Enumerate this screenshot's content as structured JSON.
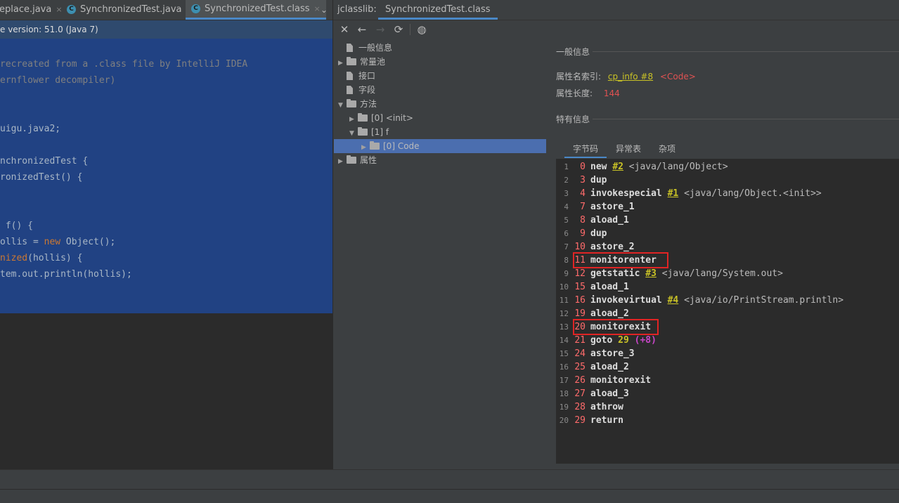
{
  "editor": {
    "tabs": [
      {
        "label": "eplace.java"
      },
      {
        "label": "SynchronizedTest.java"
      },
      {
        "label": "SynchronizedTest.class"
      }
    ],
    "tab_close": "×",
    "tab_more": "⌄",
    "infobar_text": "e version: 51.0 (Java 7)",
    "code_lines": {
      "l1": "recreated from a .class file by IntelliJ IDEA",
      "l2": "ernflower decompiler)",
      "l3": "uigu.java2;",
      "l4": "nchronizedTest {",
      "l5": "ronizedTest() {",
      "l6a": " f() {",
      "l7a": "ollis = ",
      "l7kw": "new",
      "l7b": " Object();",
      "l8kw": "nized",
      "l8b": "(hollis) {",
      "l9": "tem.out.println(hollis);"
    }
  },
  "jclasslib": {
    "label": "jclasslib:",
    "tab": "SynchronizedTest.class",
    "toolbar": {
      "close": "✕",
      "back": "←",
      "forward": "→",
      "refresh": "⟳",
      "browser": "◍"
    },
    "tree": {
      "general": "一般信息",
      "constant_pool": "常量池",
      "interfaces": "接口",
      "fields": "字段",
      "methods": "方法",
      "method0": "[0] <init>",
      "method1": "[1] f",
      "code": "[0] Code",
      "attributes": "属性"
    },
    "detail": {
      "general_header": "一般信息",
      "name_index_label": "属性名索引:",
      "name_index_link": "cp_info #8",
      "name_index_value": "<Code>",
      "length_label": "属性长度:",
      "length_value": "144",
      "specific_header": "特有信息",
      "tabs": [
        "字节码",
        "异常表",
        "杂项"
      ]
    },
    "bytecode": [
      {
        "line": "1",
        "offset": "0",
        "op": "new",
        "ref": "#2",
        "comment": "<java/lang/Object>"
      },
      {
        "line": "2",
        "offset": "3",
        "op": "dup"
      },
      {
        "line": "3",
        "offset": "4",
        "op": "invokespecial",
        "ref": "#1",
        "comment": "<java/lang/Object.<init>>"
      },
      {
        "line": "4",
        "offset": "7",
        "op": "astore_1"
      },
      {
        "line": "5",
        "offset": "8",
        "op": "aload_1"
      },
      {
        "line": "6",
        "offset": "9",
        "op": "dup"
      },
      {
        "line": "7",
        "offset": "10",
        "op": "astore_2"
      },
      {
        "line": "8",
        "offset": "11",
        "op": "monitorenter",
        "highlighted": true
      },
      {
        "line": "9",
        "offset": "12",
        "op": "getstatic",
        "ref": "#3",
        "comment": "<java/lang/System.out>"
      },
      {
        "line": "10",
        "offset": "15",
        "op": "aload_1"
      },
      {
        "line": "11",
        "offset": "16",
        "op": "invokevirtual",
        "ref": "#4",
        "comment": "<java/io/PrintStream.println>"
      },
      {
        "line": "12",
        "offset": "19",
        "op": "aload_2"
      },
      {
        "line": "13",
        "offset": "20",
        "op": "monitorexit",
        "highlighted": true
      },
      {
        "line": "14",
        "offset": "21",
        "op": "goto",
        "target": "29",
        "inc": "(+8)"
      },
      {
        "line": "15",
        "offset": "24",
        "op": "astore_3"
      },
      {
        "line": "16",
        "offset": "25",
        "op": "aload_2"
      },
      {
        "line": "17",
        "offset": "26",
        "op": "monitorexit"
      },
      {
        "line": "18",
        "offset": "27",
        "op": "aload_3"
      },
      {
        "line": "19",
        "offset": "28",
        "op": "athrow"
      },
      {
        "line": "20",
        "offset": "29",
        "op": "return"
      }
    ]
  },
  "colors": {
    "editor_selection": "#214283",
    "infobar": "#2f4a6e",
    "panel": "#3c3f41",
    "editor_bg": "#2b2b2b",
    "tree_selection": "#4b6eaf",
    "offset_red": "#ff6b6b",
    "link_yellow": "#c9c226",
    "highlight_box": "#e02424"
  }
}
